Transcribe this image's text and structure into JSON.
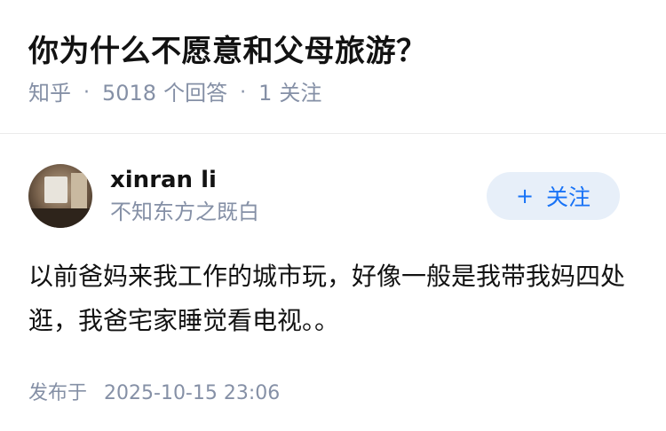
{
  "question": {
    "title": "你为什么不愿意和父母旅游？",
    "source": "知乎",
    "answers_count": "5018",
    "answers_label": "个回答",
    "followers_count": "1",
    "followers_label": "关注"
  },
  "answer": {
    "author_name": "xinran li",
    "author_bio": "不知东方之既白",
    "follow_button": "关注",
    "follow_icon": "+",
    "content": "以前爸妈来我工作的城市玩，好像一般是我带我妈四处逛，我爸宅家睡觉看电视。。",
    "published_label": "发布于",
    "published_time": "2025-10-15 23:06"
  },
  "colors": {
    "meta_gray": "#8590a6",
    "follow_bg": "#e7eff9",
    "follow_text": "#1772f6"
  }
}
